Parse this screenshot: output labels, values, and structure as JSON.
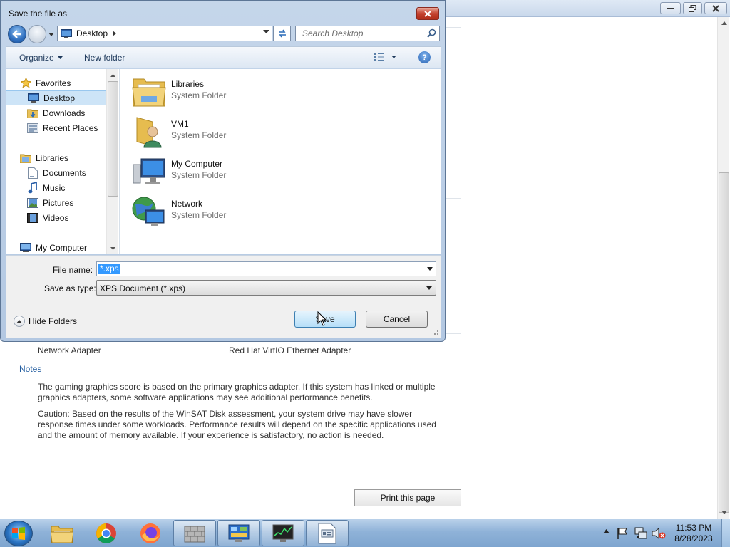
{
  "background_page": {
    "network_adapter_label": "Network Adapter",
    "network_adapter_value": "Red Hat VirtIO Ethernet Adapter",
    "notes_heading": "Notes",
    "note_1": "The gaming graphics score is based on the primary graphics adapter. If this system has linked or multiple graphics adapters, some software applications may see additional performance benefits.",
    "note_2": "Caution: Based on the results of the WinSAT Disk assessment, your system drive may have slower response times under some workloads. Performance results will depend on the specific applications used and the amount of memory available. If your experience is satisfactory, no action is needed.",
    "print_button": "Print this page"
  },
  "dialog": {
    "title": "Save the file as",
    "address": "Desktop",
    "search_placeholder": "Search Desktop",
    "toolbar": {
      "organize": "Organize",
      "new_folder": "New folder"
    },
    "nav_pane": {
      "items": [
        {
          "label": "Favorites",
          "icon": "star-icon"
        },
        {
          "label": "Desktop",
          "icon": "desktop-icon",
          "selected": true
        },
        {
          "label": "Downloads",
          "icon": "downloads-folder-icon"
        },
        {
          "label": "Recent Places",
          "icon": "recent-places-icon"
        },
        {
          "label": "Libraries",
          "icon": "libraries-icon"
        },
        {
          "label": "Documents",
          "icon": "documents-icon"
        },
        {
          "label": "Music",
          "icon": "music-icon"
        },
        {
          "label": "Pictures",
          "icon": "pictures-icon"
        },
        {
          "label": "Videos",
          "icon": "videos-icon"
        },
        {
          "label": "My Computer",
          "icon": "computer-icon"
        }
      ]
    },
    "files": [
      {
        "name": "Libraries",
        "type": "System Folder",
        "icon": "libraries-folder-icon"
      },
      {
        "name": "VM1",
        "type": "System Folder",
        "icon": "user-folder-icon"
      },
      {
        "name": "My Computer",
        "type": "System Folder",
        "icon": "computer-icon"
      },
      {
        "name": "Network",
        "type": "System Folder",
        "icon": "network-icon"
      }
    ],
    "file_name_label": "File name:",
    "file_name_value": "*.xps",
    "save_as_type_label": "Save as type:",
    "save_as_type_value": "XPS Document (*.xps)",
    "hide_folders": "Hide Folders",
    "save_button": "Save",
    "cancel_button": "Cancel"
  },
  "taskbar": {
    "apps": [
      {
        "name": "file-explorer",
        "icon": "folder-icon"
      },
      {
        "name": "chrome",
        "icon": "chrome-icon"
      },
      {
        "name": "firefox",
        "icon": "firefox-icon"
      },
      {
        "name": "firewall",
        "icon": "firewall-icon"
      },
      {
        "name": "control-panel",
        "icon": "control-panel-icon"
      },
      {
        "name": "resource-monitor",
        "icon": "monitor-icon"
      },
      {
        "name": "document-viewer",
        "icon": "document-icon"
      }
    ],
    "clock_time": "11:53 PM",
    "clock_date": "8/28/2023"
  }
}
